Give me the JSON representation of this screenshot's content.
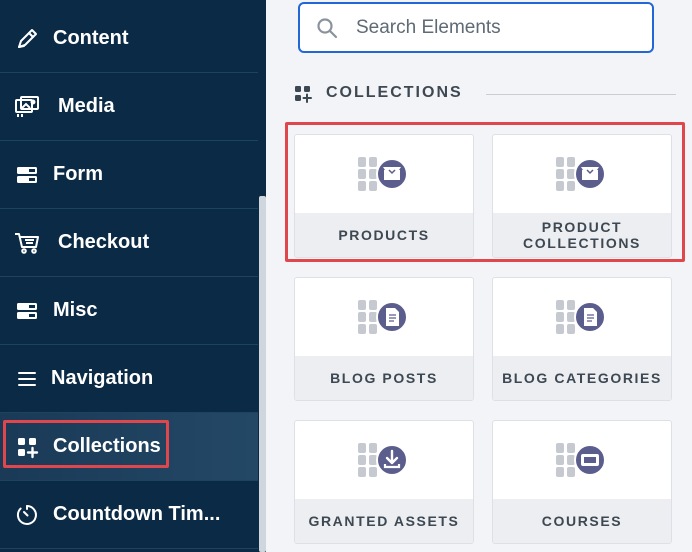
{
  "sidebar": {
    "items": [
      {
        "label": "Content",
        "icon": "pen-icon"
      },
      {
        "label": "Media",
        "icon": "media-icon"
      },
      {
        "label": "Form",
        "icon": "form-icon"
      },
      {
        "label": "Checkout",
        "icon": "cart-icon"
      },
      {
        "label": "Misc",
        "icon": "misc-icon"
      },
      {
        "label": "Navigation",
        "icon": "menu-icon"
      },
      {
        "label": "Collections",
        "icon": "collections-icon",
        "active": true
      },
      {
        "label": "Countdown Tim...",
        "icon": "timer-icon"
      }
    ]
  },
  "search": {
    "placeholder": "Search Elements"
  },
  "section": {
    "title": "COLLECTIONS"
  },
  "cards": [
    {
      "label": "PRODUCTS",
      "icon": "product-box-icon"
    },
    {
      "label": "PRODUCT\nCOLLECTIONS",
      "icon": "product-box-icon"
    },
    {
      "label": "BLOG POSTS",
      "icon": "document-icon"
    },
    {
      "label": "BLOG CATEGORIES",
      "icon": "document-icon"
    },
    {
      "label": "GRANTED ASSETS",
      "icon": "download-icon"
    },
    {
      "label": "COURSES",
      "icon": "course-screen-icon"
    }
  ],
  "colors": {
    "sidebar_bg": "#0b2a45",
    "highlight": "#e0474c",
    "search_border": "#2267d6",
    "icon_purple": "#5b5e8c"
  }
}
